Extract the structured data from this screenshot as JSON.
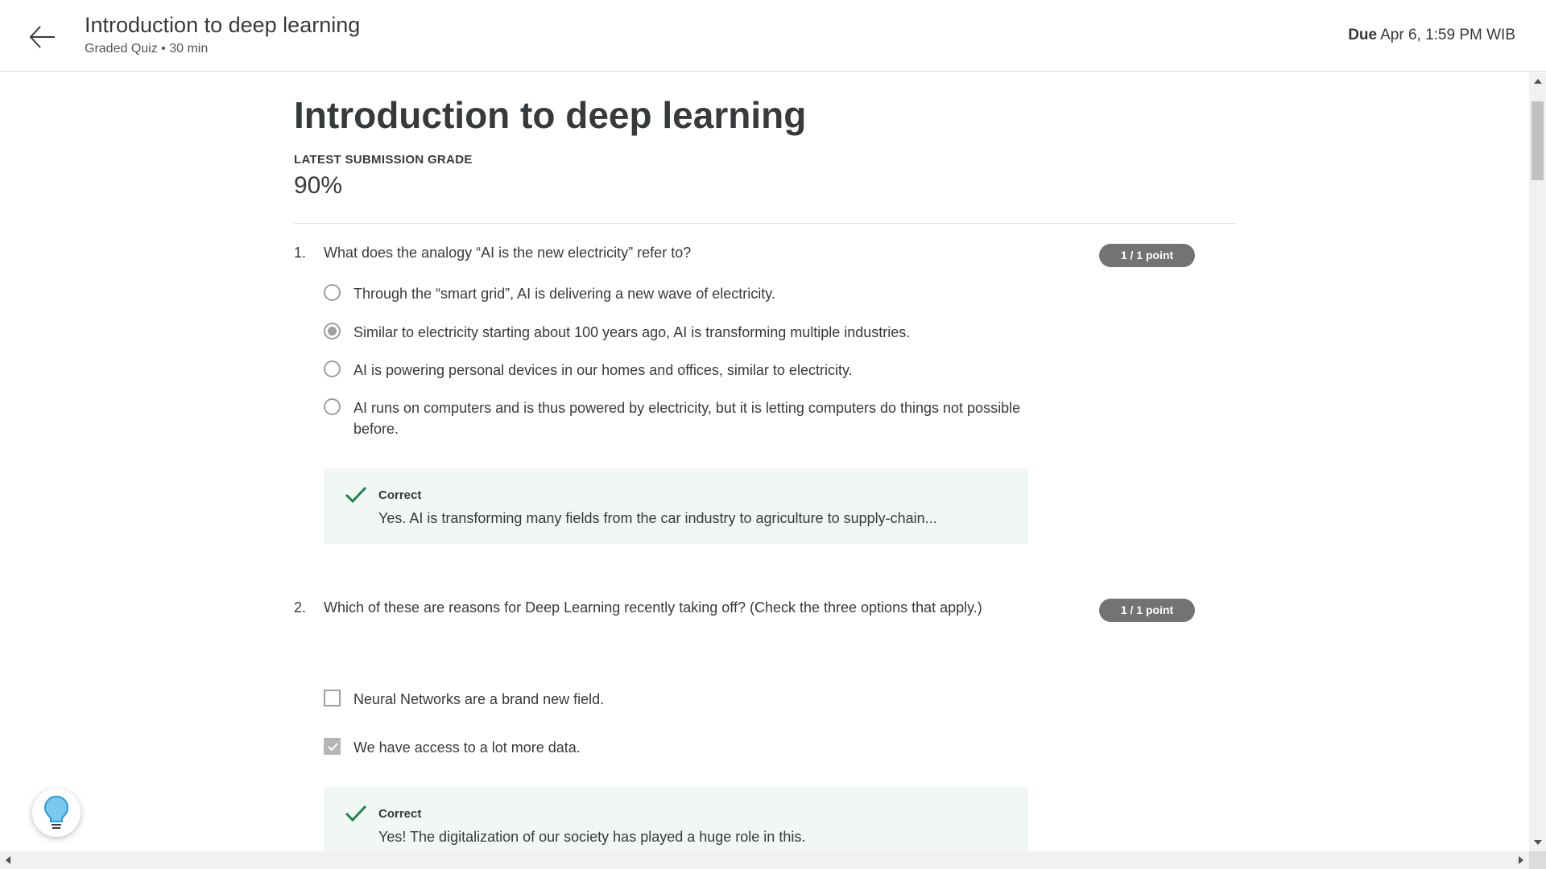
{
  "header": {
    "title": "Introduction to deep learning",
    "subtitle": "Graded Quiz • 30 min",
    "due_label": "Due",
    "due_value": "Apr 6, 1:59 PM WIB"
  },
  "page": {
    "title": "Introduction to deep learning",
    "grade_label": "LATEST SUBMISSION GRADE",
    "grade_value": "90%"
  },
  "questions": [
    {
      "number": "1.",
      "text": "What does the analogy “AI is the new electricity” refer to?",
      "points": "1 / 1 point",
      "type": "radio",
      "options": [
        {
          "label": "Through the “smart grid”, AI is delivering a new wave of electricity.",
          "selected": false
        },
        {
          "label": "Similar to electricity starting about 100 years ago, AI is transforming multiple industries.",
          "selected": true
        },
        {
          "label": "AI is powering personal devices in our homes and offices, similar to electricity.",
          "selected": false
        },
        {
          "label": "AI runs on computers and is thus powered by electricity, but it is letting computers do things not possible before.",
          "selected": false
        }
      ],
      "feedback": {
        "title": "Correct",
        "text": "Yes. AI is transforming many fields from the car industry to agriculture to supply-chain..."
      }
    },
    {
      "number": "2.",
      "text": "Which of these are reasons for Deep Learning recently taking off? (Check the three options that apply.)",
      "points": "1 / 1 point",
      "type": "checkbox",
      "options": [
        {
          "label": "Neural Networks are a brand new field.",
          "selected": false
        },
        {
          "label": "We have access to a lot more data.",
          "selected": true
        }
      ],
      "feedback": {
        "title": "Correct",
        "text": "Yes! The digitalization of our society has played a huge role in this."
      }
    }
  ],
  "colors": {
    "feedback_bg": "#f1f7f4",
    "check_green": "#1f8354",
    "badge_bg": "#737373",
    "help_icon": "#2a9bd8"
  },
  "icons": {
    "back": "arrow-left-icon",
    "correct": "checkmark-icon",
    "help": "lightbulb-icon"
  }
}
